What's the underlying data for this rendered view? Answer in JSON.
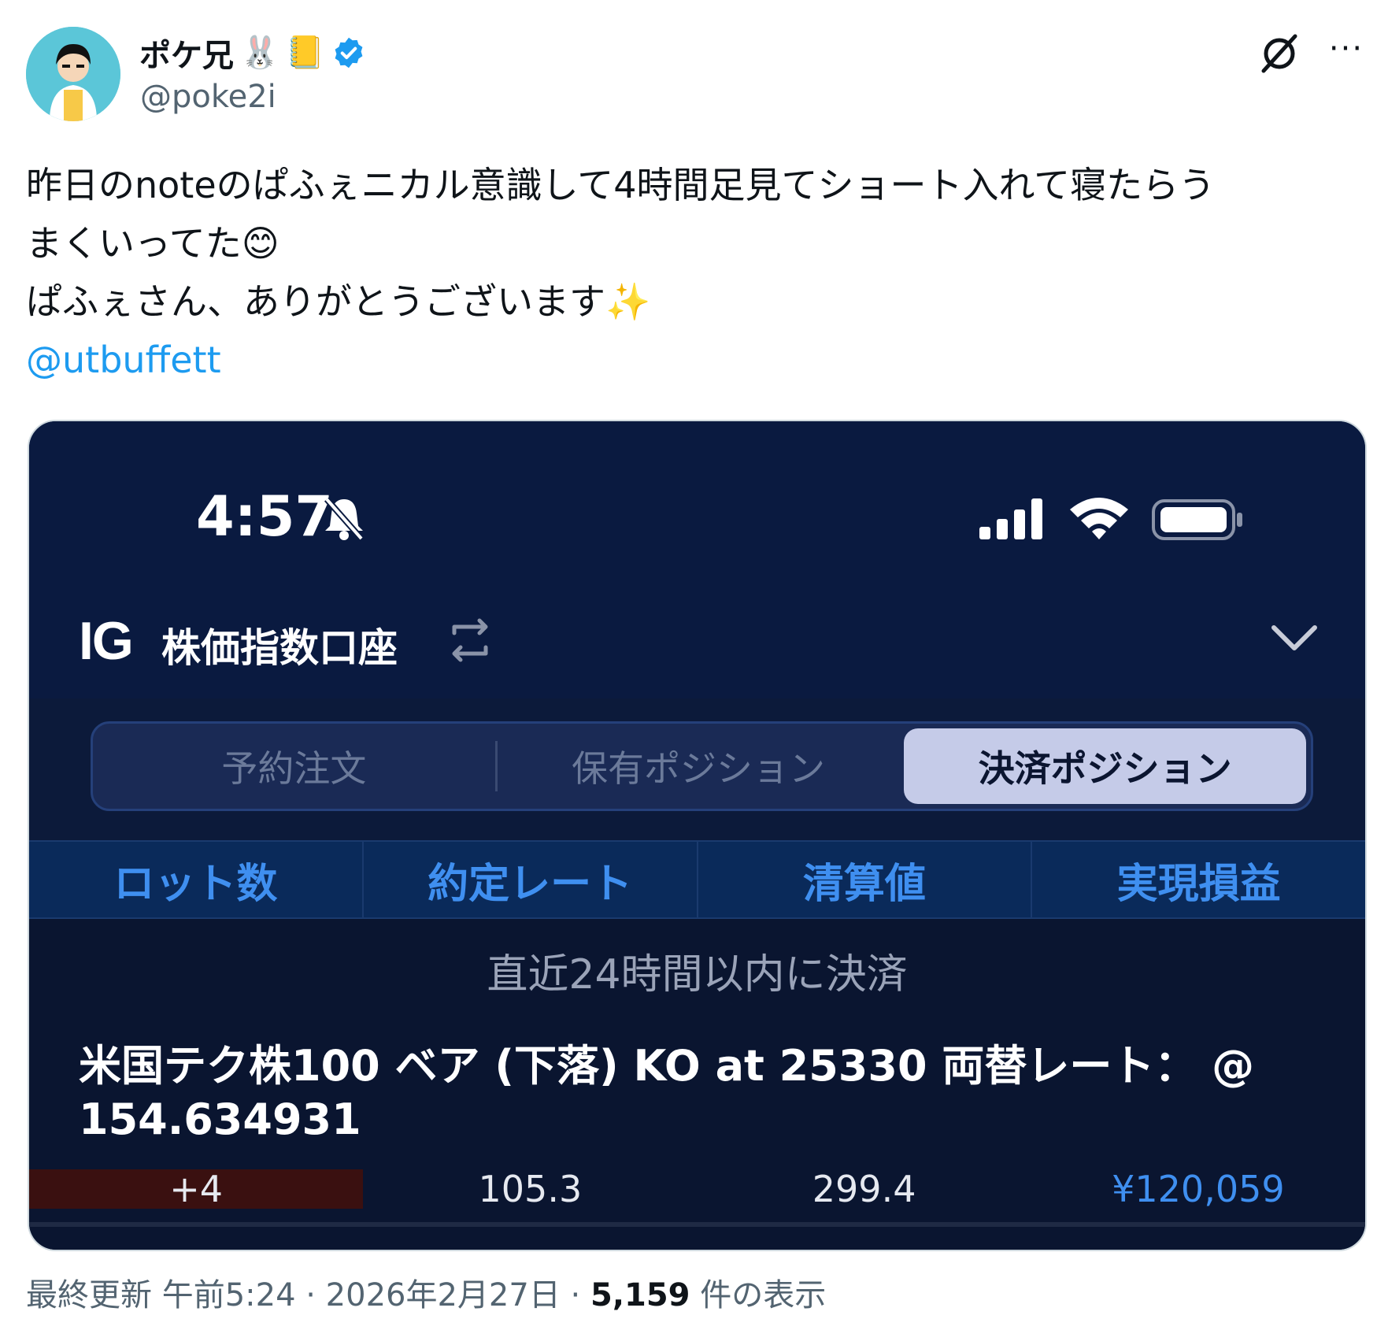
{
  "author": {
    "name": "ポケ兄",
    "name_emojis": [
      "🐰",
      "📒"
    ],
    "handle": "@poke2i",
    "verified": true
  },
  "tweet": {
    "line1": "昨日のnoteのぱふぇニカル意識して4時間足見てショート入れて寝たらう",
    "line2": "まくいってた😊",
    "line3": "ぱふぇさん、ありがとうございます✨",
    "mention": "@utbuffett"
  },
  "screenshot": {
    "clock": "4:57",
    "brand": "IG",
    "account": "株価指数口座",
    "tabs": [
      "予約注文",
      "保有ポジション",
      "決済ポジション"
    ],
    "active_tab": "決済ポジション",
    "columns": [
      "ロット数",
      "約定レート",
      "清算値",
      "実現損益"
    ],
    "section_label": "直近24時間以内に決済",
    "instrument_line1": "米国テク株100 ベア (下落) KO at 25330 両替レート： @",
    "instrument_line2": "154.634931",
    "row": {
      "lots": "+4",
      "rate": "105.3",
      "settle": "299.4",
      "pnl": "¥120,059"
    }
  },
  "footer": {
    "prefix": "最終更新 午前5:24 · 2026年2月27日 · ",
    "views": "5,159",
    "suffix": " 件の表示"
  },
  "colors": {
    "link": "#1d9bf0",
    "card_bg": "#0a1a40",
    "accent_blue": "#3f8ff0",
    "active_tab": "#c5cbe8",
    "lots_bg": "#3a1010"
  }
}
